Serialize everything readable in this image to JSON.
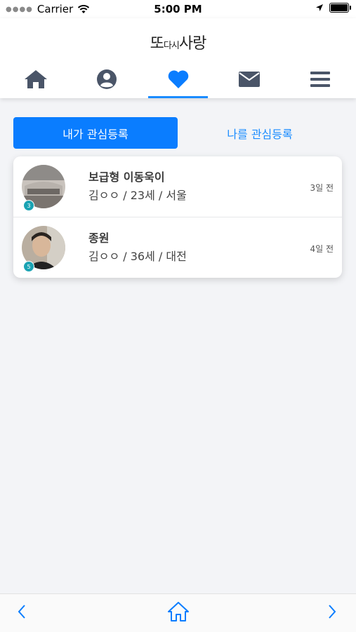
{
  "status": {
    "carrier": "Carrier",
    "time": "5:00 PM"
  },
  "app": {
    "logo_main": "또",
    "logo_small": "다시",
    "logo_end": "사랑"
  },
  "nav": {
    "items": [
      {
        "icon": "home-icon"
      },
      {
        "icon": "profile-icon"
      },
      {
        "icon": "heart-icon",
        "active": true
      },
      {
        "icon": "mail-icon"
      },
      {
        "icon": "menu-icon"
      }
    ]
  },
  "tabs": {
    "my_interest": "내가 관심등록",
    "interested_in_me": "나를 관심등록"
  },
  "list": [
    {
      "name": "보급형 이동욱이",
      "meta": "김ㅇㅇ / 23세 / 서울",
      "ago": "3일 전",
      "badge": "3"
    },
    {
      "name": "종원",
      "meta": "김ㅇㅇ / 36세 / 대전",
      "ago": "4일 전",
      "badge": "5"
    }
  ],
  "colors": {
    "accent": "#0a7dff",
    "nav_icon": "#4a5568",
    "badge": "#1aa3b3"
  }
}
